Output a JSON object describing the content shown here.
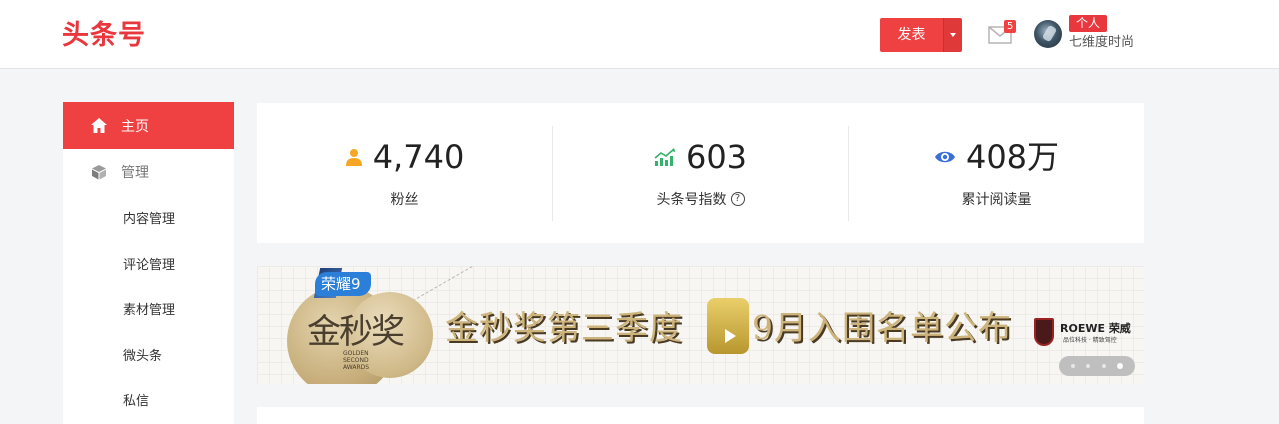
{
  "header": {
    "logo": "头条号",
    "publish_label": "发表",
    "mail_count": "5",
    "user_role": "个人",
    "user_name": "七维度时尚"
  },
  "sidebar": {
    "home_label": "主页",
    "manage_label": "管理",
    "sub_items": [
      "内容管理",
      "评论管理",
      "素材管理",
      "微头条",
      "私信"
    ]
  },
  "stats": [
    {
      "value": "4,740",
      "label": "粉丝",
      "icon": "user-icon",
      "color": "#f5a623"
    },
    {
      "value": "603",
      "label": "头条号指数",
      "icon": "trend-chart-icon",
      "color": "#34b36c"
    },
    {
      "value": "408万",
      "label": "累计阅读量",
      "icon": "eye-icon",
      "color": "#3a6fd8"
    }
  ],
  "banner": {
    "honor_tag": "荣耀9",
    "medal_text": "金秒奖",
    "medal_sub": "GOLDEN SECOND AWARDS",
    "title_part1": "金秒奖第三季度",
    "title_part2": "9月入围名单公布",
    "brand": "ROEWE 荣威",
    "brand_slogan": "品位科技 · 精致驾控",
    "slides_total": 4,
    "slide_active": 4
  },
  "colors": {
    "brand_red": "#f04142",
    "logo_red": "#e8373d"
  }
}
